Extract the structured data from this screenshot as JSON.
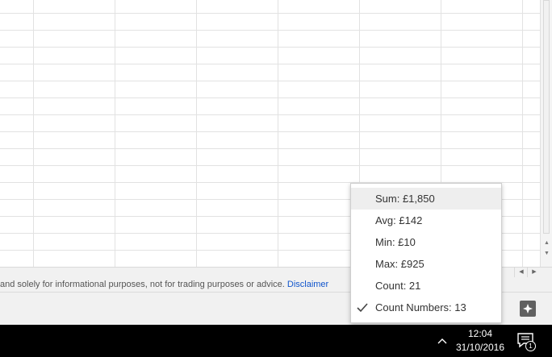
{
  "disclaimer": {
    "text": "and solely for informational purposes, not for trading purposes or advice.",
    "link": "Disclaimer"
  },
  "stats_menu": {
    "items": [
      {
        "label": "Sum: £1,850",
        "checked": false
      },
      {
        "label": "Avg: £142",
        "checked": false
      },
      {
        "label": "Min: £10",
        "checked": false
      },
      {
        "label": "Max: £925",
        "checked": false
      },
      {
        "label": "Count: 21",
        "checked": false
      },
      {
        "label": "Count Numbers: 13",
        "checked": true
      }
    ]
  },
  "taskbar": {
    "time": "12:04",
    "date": "31/10/2016",
    "notification_count": "1"
  },
  "icons": {
    "explore": "explore-icon",
    "check": "check-icon",
    "tray": "chevron-up-icon",
    "notifications": "notification-icon"
  },
  "colors": {
    "link": "#1155cc",
    "explore_button": "#616161",
    "taskbar": "#000000"
  }
}
